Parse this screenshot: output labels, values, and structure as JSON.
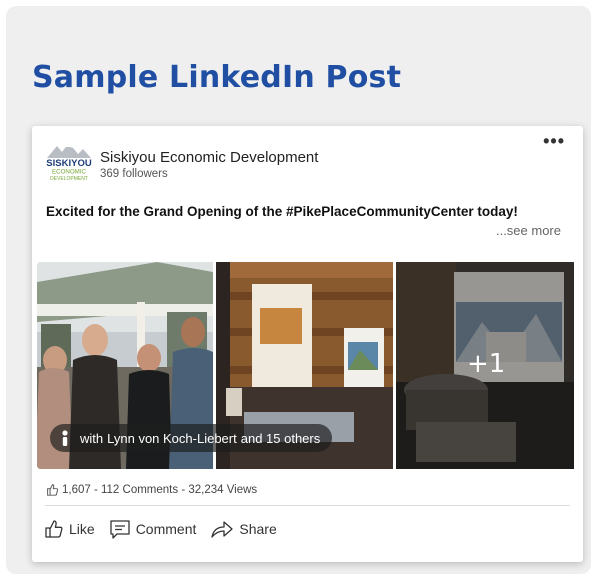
{
  "page": {
    "heading": "Sample LinkedIn Post"
  },
  "post": {
    "org_logo": {
      "line1": "SISKIYOU",
      "line2": "ECONOMIC",
      "line3": "DEVELOPMENT"
    },
    "org_name": "Siskiyou Economic Development",
    "followers": "369 followers",
    "more_menu": "•••",
    "text": "Excited for the Grand Opening of the #PikePlaceCommunityCenter today!",
    "see_more": "...see more",
    "tag": {
      "prefix": "with",
      "person": "Lynn von Koch-Liebert",
      "suffix": "and 15 others"
    },
    "extra_photos": "+1",
    "stats": "1,607 - 112 Comments - 32,234 Views",
    "actions": {
      "like": "Like",
      "comment": "Comment",
      "share": "Share"
    }
  },
  "colors": {
    "heading": "#1f4ea3",
    "panel": "#efefef",
    "logo_green": "#7aa83a"
  }
}
